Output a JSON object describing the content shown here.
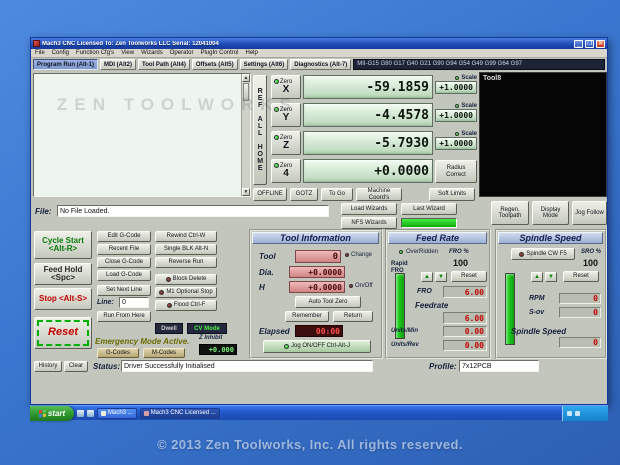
{
  "colors": {
    "desktop_blue": "#3a76cf",
    "titlebar_blue": "#1c49b4",
    "panel_gray": "#c2c6bd",
    "dro_green": "#cfe6cf",
    "dro_red": "#d89090",
    "value_red": "#c40000",
    "led_green": "#22cc22",
    "slider_green": "#18c818",
    "taskbar_blue": "#2a64d8",
    "start_green": "#3aad3a"
  },
  "icons": {
    "minimize": "_",
    "maximize": "❐",
    "close": "✕",
    "up_arrow": "▲",
    "down_arrow": "▼"
  },
  "desktop": {
    "copyright": "© 2013 Zen Toolworks, Inc. All rights reserved."
  },
  "window": {
    "title": "Mach3 CNC  Licensed To:  Zen Toolworks LLC Serial: 12041004",
    "menu": [
      "File",
      "Config",
      "Function Cfg's",
      "View",
      "Wizards",
      "Operator",
      "PlugIn Control",
      "Help"
    ]
  },
  "tabs": {
    "program_run": "Program Run (Alt-1)",
    "mdi": "MDI (Alt2)",
    "tool_path": "Tool Path (Alt4)",
    "offsets": "Offsets (Alt5)",
    "settings": "Settings (Alt6)",
    "diagnostics": "Diagnostics (Alt-7)",
    "gcode_modes": "MII-G15 G80 G17 G40 G21 G90 G94 G54 G49 G99 G64 G97"
  },
  "gcode_window": {
    "watermark": "ZEN TOOLWORKS"
  },
  "dro": {
    "ref_all_home": "REF ALL HOME",
    "zero_label": "Zero",
    "scale_label": "Scale",
    "axes": [
      {
        "axis": "X",
        "value": "-59.1859",
        "scale": "+1.0000"
      },
      {
        "axis": "Y",
        "value": "-4.4578",
        "scale": "+1.0000"
      },
      {
        "axis": "Z",
        "value": "-5.7930",
        "scale": "+1.0000"
      },
      {
        "axis": "4",
        "value": "+0.0000"
      }
    ],
    "radius_correct": "Radius Correct",
    "offline": "OFFLINE",
    "gotz": "GOTZ",
    "to_go": "To Go",
    "machine_coords": "Machine Coord's",
    "soft_limits": "Soft Limits"
  },
  "toolpath": {
    "tool_label": "Tool8"
  },
  "file_bar": {
    "label": "File:",
    "value": "No File Loaded.",
    "load_wizards": "Load Wizards",
    "last_wizard": "Last Wizard",
    "nfs_wizards": "NFS Wizards",
    "regen_toolpath": "Regen. Toolpath",
    "display_mode": "Display Mode",
    "jog_follow": "Jog Follow"
  },
  "control": {
    "cycle_start": "Cycle Start <Alt-R>",
    "feed_hold": "Feed Hold <Spc>",
    "stop": "Stop <Alt-S>",
    "reset": "Reset"
  },
  "gcode_ops": {
    "edit": "Edit G-Code",
    "recent": "Recent File",
    "close": "Close G-Code",
    "load": "Load G-Code",
    "set_next_line": "Set Next Line",
    "line_label": "Line:",
    "line_value": "0",
    "run_from_here": "Run From Here",
    "rewind": "Rewind Ctrl-W",
    "single_blk": "Single BLK Alt-N",
    "reverse_run": "Reverse Run",
    "block_delete": "Block Delete",
    "m1_optional_stop": "M1 Optional Stop",
    "flood": "Flood Ctrl-F",
    "dwell": "Dwell",
    "cv_mode": "CV Mode",
    "emergency": "Emergency Mode Active.",
    "g_codes": "G-Codes",
    "m_codes": "M-Codes",
    "z_inhibit_label": "Z Inhibit",
    "z_inhibit_value": "+0.000"
  },
  "tool_info": {
    "title": "Tool Information",
    "tool_label": "Tool",
    "tool_value": "0",
    "change_label": "Change",
    "dia_label": "Dia.",
    "dia_value": "+0.0000",
    "h_label": "H",
    "h_value": "+0.0000",
    "on_off_label": "On/Off",
    "auto_tool_zero": "Auto Tool Zero",
    "remember": "Remember",
    "return": "Return",
    "elapsed_label": "Elapsed",
    "elapsed_value": "00:00",
    "jog_on_off": "Jog ON/OFF Ctrl-Alt-J"
  },
  "feed_rate": {
    "title": "Feed Rate",
    "overridden": "OverRidden",
    "fro_pct_label": "FRO %",
    "rapid_fro_label": "Rapid FRO",
    "fro_pct_value": "100",
    "reset": "Reset",
    "fro_label": "FRO",
    "fro_value": "6.00",
    "feedrate_label": "Feedrate",
    "feedrate_value": "6.00",
    "units_min_label": "Units/Min",
    "units_min_value": "0.00",
    "units_rev_label": "Units/Rev",
    "units_rev_value": "0.00"
  },
  "spindle": {
    "title": "Spindle Speed",
    "spindle_cw": "Spindle CW F5",
    "sro_pct_label": "SRO %",
    "sro_pct_value": "100",
    "reset": "Reset",
    "rpm_label": "RPM",
    "rpm_value": "0",
    "sov_label": "S-ov",
    "sov_value": "0",
    "spindle_speed_label": "Spindle Speed",
    "spindle_speed_value": "0"
  },
  "status_bar": {
    "history": "History",
    "clear": "Clear",
    "status_label": "Status:",
    "status_value": "Driver Successfully Initialised",
    "profile_label": "Profile:",
    "profile_value": "7x12PCB"
  },
  "taskbar": {
    "start": "start",
    "tasks": [
      "Mach3 ...",
      "Mach3 CNC Licensed ..."
    ]
  }
}
